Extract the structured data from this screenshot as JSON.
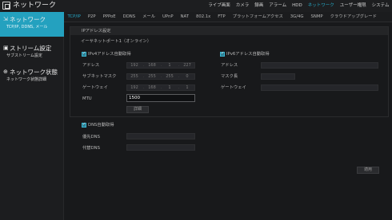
{
  "app": {
    "title": "ネットワーク"
  },
  "topmenu": [
    "ライブ画面",
    "カメラ",
    "録画",
    "アラーム",
    "HDD",
    "ネットワーク",
    "ユーザー権限",
    "システム"
  ],
  "topmenu_active": 5,
  "sidebar": {
    "items": [
      {
        "title": "ネットワーク",
        "sub": "TCP/IP, DDNS, メール",
        "icon": "network-icon"
      },
      {
        "title": "ストリーム設定",
        "sub": "サブストリーム設定",
        "icon": "stream-icon"
      },
      {
        "title": "ネットワーク状態",
        "sub": "ネットワーク状態詳細",
        "icon": "status-icon"
      }
    ]
  },
  "tabs": [
    "TCP/IP",
    "P2P",
    "PPPoE",
    "DDNS",
    "メール",
    "UPnP",
    "NAT",
    "802.1x",
    "FTP",
    "プラットフォームアクセス",
    "3G/4G",
    "SNMP",
    "クラウドアップグレード"
  ],
  "tabs_active": 0,
  "panel": {
    "header": "IPアドレス設定",
    "ethernet_label": "イーサネットポート1（オンライン）",
    "ipv4": {
      "auto_label": "IPv4アドレス自動取得",
      "auto_checked": true,
      "address_label": "アドレス",
      "address": [
        "192",
        "168",
        "1",
        "227"
      ],
      "mask_label": "サブネットマスク",
      "mask": [
        "255",
        "255",
        "255",
        "0"
      ],
      "gateway_label": "ゲートウェイ",
      "gateway": [
        "192",
        "168",
        "1",
        "1"
      ],
      "mtu_label": "MTU",
      "mtu_value": "1500",
      "detail_button": "詳細"
    },
    "ipv6": {
      "auto_label": "IPv6アドレス自動取得",
      "auto_checked": true,
      "address_label": "アドレス",
      "mask_label": "マスク長",
      "gateway_label": "ゲートウェイ"
    }
  },
  "dns": {
    "auto_label": "DNS自動取得",
    "auto_checked": true,
    "preferred_label": "優先DNS",
    "alternate_label": "代替DNS"
  },
  "apply_button": "適用",
  "colors": {
    "accent": "#24a1bf",
    "background": "#18191b"
  }
}
